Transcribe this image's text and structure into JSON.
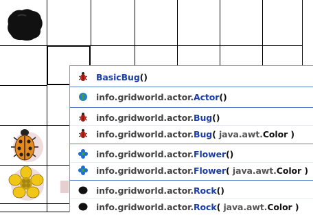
{
  "menu": {
    "items": [
      {
        "pkg": "",
        "name": "BasicBug",
        "paren": "(",
        "args": "",
        "close": ")",
        "icon": "bug-icon"
      },
      {
        "pkg": "info.gridworld.actor.",
        "name": "Actor",
        "paren": "(",
        "args": "",
        "close": ")",
        "icon": "actor-icon"
      },
      {
        "pkg": "info.gridworld.actor.",
        "name": "Bug",
        "paren": "(",
        "args": "",
        "close": ")",
        "icon": "bug-icon"
      },
      {
        "pkg": "info.gridworld.actor.",
        "name": "Bug",
        "paren": "(",
        "args": " java.awt.",
        "close": "Color )",
        "icon": "bug-icon"
      },
      {
        "pkg": "info.gridworld.actor.",
        "name": "Flower",
        "paren": "(",
        "args": "",
        "close": ")",
        "icon": "flower-icon"
      },
      {
        "pkg": "info.gridworld.actor.",
        "name": "Flower",
        "paren": "(",
        "args": " java.awt.",
        "close": "Color )",
        "icon": "flower-icon"
      },
      {
        "pkg": "info.gridworld.actor.",
        "name": "Rock",
        "paren": "(",
        "args": "",
        "close": ")",
        "icon": "rock-icon"
      },
      {
        "pkg": "info.gridworld.actor.",
        "name": "Rock",
        "paren": "(",
        "args": " java.awt.",
        "close": "Color )",
        "icon": "rock-icon"
      }
    ]
  },
  "colors": {
    "link": "#1a3da8",
    "separator": "#5a7fc8",
    "grid": "#000000"
  }
}
